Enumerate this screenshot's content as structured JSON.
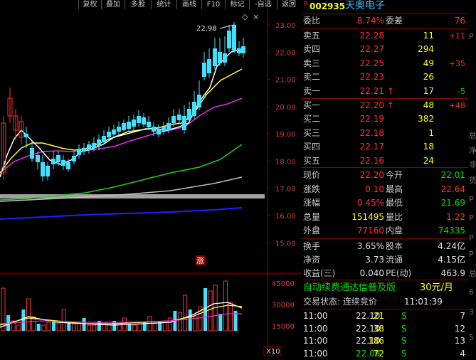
{
  "toolbar": {
    "buttons": [
      "复权",
      "叠加",
      "多股",
      "统计",
      "画线",
      "F10",
      "标记",
      "-自选",
      "返回"
    ]
  },
  "price_chart": {
    "y_ticks": [
      "23.00",
      "22.00",
      "21.00",
      "20.00",
      "19.00",
      "18.00",
      "17.00",
      "16.00",
      "15.00"
    ],
    "high_label": "22.98",
    "limit_marker": "涨",
    "collapse_icon": "diamond-icon",
    "close_icon": "close-icon"
  },
  "volume_chart": {
    "y_ticks": [
      "45000",
      "30000",
      "15000"
    ],
    "unit_label": "X10"
  },
  "quote": {
    "code_marker": "R",
    "code": "002935",
    "name": "天奥电子",
    "webi_label": "委比",
    "webi_value": "8.74%",
    "weicha_label": "委差",
    "weicha_value": "76",
    "asks": [
      {
        "label": "卖五",
        "price": "22.28",
        "vol": "11",
        "chg": "+11"
      },
      {
        "label": "卖四",
        "price": "22.27",
        "vol": "294",
        "chg": ""
      },
      {
        "label": "卖三",
        "price": "22.25",
        "vol": "49",
        "chg": "+35"
      },
      {
        "label": "卖二",
        "price": "22.23",
        "vol": "26",
        "chg": ""
      },
      {
        "label": "卖一",
        "price": "22.21",
        "vol": "17",
        "chg": "-5"
      }
    ],
    "bids": [
      {
        "label": "买一",
        "price": "22.20",
        "vol": "48",
        "chg": "+48"
      },
      {
        "label": "买二",
        "price": "22.19",
        "vol": "382",
        "chg": ""
      },
      {
        "label": "买三",
        "price": "22.18",
        "vol": "1",
        "chg": ""
      },
      {
        "label": "买四",
        "price": "22.17",
        "vol": "18",
        "chg": ""
      },
      {
        "label": "买五",
        "price": "22.16",
        "vol": "24",
        "chg": ""
      }
    ],
    "stats": [
      {
        "l1": "现价",
        "v1": "22.20",
        "l2": "今开",
        "v2": "22.01",
        "c1": "red",
        "c2": "grn"
      },
      {
        "l1": "涨跌",
        "v1": "0.10",
        "l2": "最高",
        "v2": "22.64",
        "c1": "red",
        "c2": "red"
      },
      {
        "l1": "涨幅",
        "v1": "0.45%",
        "l2": "最低",
        "v2": "21.69",
        "c1": "red",
        "c2": "grn"
      },
      {
        "l1": "总量",
        "v1": "151495",
        "l2": "量比",
        "v2": "1.22",
        "c1": "yel",
        "c2": "red"
      },
      {
        "l1": "外盘",
        "v1": "77160",
        "l2": "内盘",
        "v2": "74335",
        "c1": "red",
        "c2": "grn"
      }
    ],
    "stats2": [
      {
        "l1": "换手",
        "v1": "3.65%",
        "l2": "股本",
        "v2": "4.24亿"
      },
      {
        "l1": "净资",
        "v1": "3.73",
        "l2": "流通",
        "v2": "4.15亿"
      },
      {
        "l1": "收益(三)",
        "v1": "0.040",
        "l2": "PE(动)",
        "v2": "463.9"
      }
    ],
    "promo": "自动续费通达信普及版",
    "promo_price": "30元/月",
    "trade_status": "交易状态: 连续竞价",
    "trade_time": "11:01:39",
    "ticks": [
      {
        "time": "11:00",
        "price": "22.10",
        "vol": "21",
        "side": "S",
        "n": "7"
      },
      {
        "time": "11:00",
        "price": "22.10",
        "vol": "38",
        "side": "S",
        "n": "12"
      },
      {
        "time": "11:00",
        "price": "22.10",
        "vol": "186",
        "side": "S",
        "n": "13"
      },
      {
        "time": "11:00",
        "price": "22.09",
        "vol": "72",
        "side": "S",
        "n": "4"
      }
    ]
  },
  "edge_chars": [
    "P",
    "总",
    "净",
    "非",
    "货",
    "P",
    "P",
    "P",
    "P",
    "总",
    "6",
    "3",
    "5"
  ]
}
